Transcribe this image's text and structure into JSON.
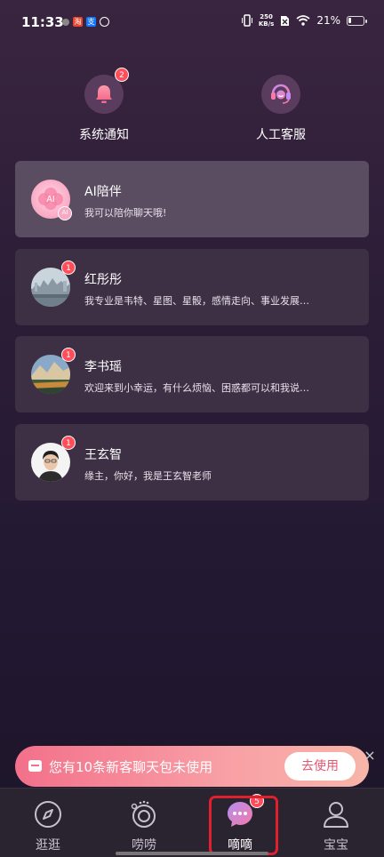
{
  "status_bar": {
    "time": "11:33",
    "net_speed_top": "250",
    "net_speed_bottom": "KB/s",
    "battery": "21%"
  },
  "shortcuts": {
    "notice": {
      "label": "系统通知",
      "badge": "2",
      "icon": "bell-icon"
    },
    "service": {
      "label": "人工客服",
      "icon": "headset-icon"
    }
  },
  "chats": [
    {
      "name": "AI陪伴",
      "message": "我可以陪你聊天哦!",
      "badge": "",
      "avatar_text": "AI",
      "avatar_sub": "AI"
    },
    {
      "name": "红彤彤",
      "message": "我专业是韦特、星图、星骰，感情走向、事业发展…",
      "badge": "1"
    },
    {
      "name": "李书瑶",
      "message": "欢迎来到小幸运，有什么烦恼、困惑都可以和我说…",
      "badge": "1"
    },
    {
      "name": "王玄智",
      "message": "缘主，你好，我是王玄智老师",
      "badge": "1"
    }
  ],
  "promo": {
    "text": "您有10条新客聊天包未使用",
    "button": "去使用",
    "close": "×"
  },
  "nav": [
    {
      "label": "逛逛",
      "icon": "compass-icon",
      "badge": ""
    },
    {
      "label": "唠唠",
      "icon": "camera-lens-icon",
      "badge": ""
    },
    {
      "label": "嘀嘀",
      "icon": "chat-bubble-icon",
      "badge": "5"
    },
    {
      "label": "宝宝",
      "icon": "user-icon",
      "badge": ""
    }
  ],
  "colors": {
    "accent": "#ff4d5a",
    "promo_start": "#f3708a",
    "highlight": "#e0202c"
  }
}
